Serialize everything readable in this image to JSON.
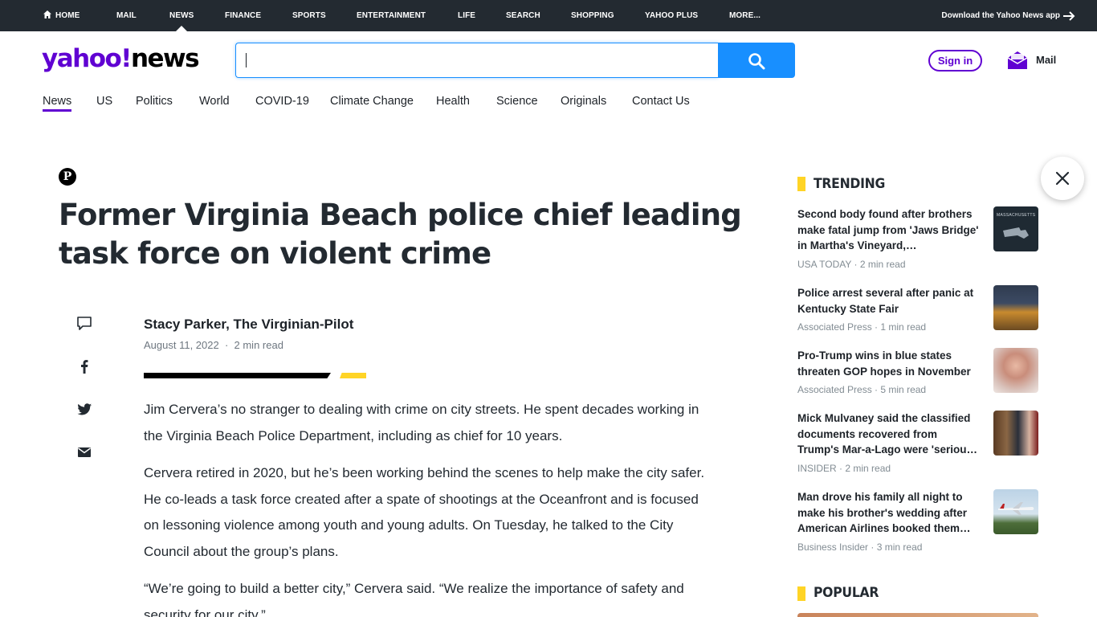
{
  "topnav": {
    "items": [
      "HOME",
      "MAIL",
      "NEWS",
      "FINANCE",
      "SPORTS",
      "ENTERTAINMENT",
      "LIFE",
      "SEARCH",
      "SHOPPING",
      "YAHOO PLUS",
      "MORE..."
    ],
    "active": "NEWS",
    "download": "Download the Yahoo News app"
  },
  "header": {
    "logo_yahoo": "yahoo!",
    "logo_news": "news",
    "search_value": "",
    "signin": "Sign in",
    "mail": "Mail"
  },
  "subnav": {
    "items": [
      "News",
      "US",
      "Politics",
      "World",
      "COVID-19",
      "Climate Change",
      "Health",
      "Science",
      "Originals",
      "Contact Us"
    ],
    "active": "News"
  },
  "article": {
    "publisher_initial": "P",
    "headline": "Former Virginia Beach police chief leading task force on violent crime",
    "author": "Stacy Parker, The Virginian-Pilot",
    "date": "August 11, 2022",
    "read_time": "2 min read",
    "paragraphs": [
      "Jim Cervera’s no stranger to dealing with crime on city streets. He spent decades working in the Virginia Beach Police Department, including as chief for 10 years.",
      "Cervera retired in 2020, but he’s been working behind the scenes to help make the city safer. He co-leads a task force created after a spate of shootings at the Oceanfront and is focused on lessoning violence among youth and young adults. On Tuesday, he talked to the City Council about the group’s plans.",
      "“We’re going to build a better city,” Cervera said. “We realize the importance of safety and security for our city.”"
    ]
  },
  "trending": {
    "title": "TRENDING",
    "items": [
      {
        "title": "Second body found after brothers make fatal jump from 'Jaws Bridge' in Martha's Vineyard,…",
        "source": "USA TODAY",
        "read": "2 min read",
        "thumb_text": "MASSACHUSETTS"
      },
      {
        "title": "Police arrest several after panic at Kentucky State Fair",
        "source": "Associated Press",
        "read": "1 min read"
      },
      {
        "title": "Pro-Trump wins in blue states threaten GOP hopes in November",
        "source": "Associated Press",
        "read": "5 min read"
      },
      {
        "title": "Mick Mulvaney said the classified documents recovered from Trump's Mar-a-Lago were 'seriou…",
        "source": "INSIDER",
        "read": "2 min read"
      },
      {
        "title": "Man drove his family all night to make his brother's wedding after American Airlines booked them…",
        "source": "Business Insider",
        "read": "3 min read"
      }
    ]
  },
  "popular": {
    "title": "POPULAR"
  },
  "colors": {
    "brand": "#6001d2",
    "accent": "#188fff",
    "topbar": "#232a31",
    "section": "#ffd426"
  }
}
